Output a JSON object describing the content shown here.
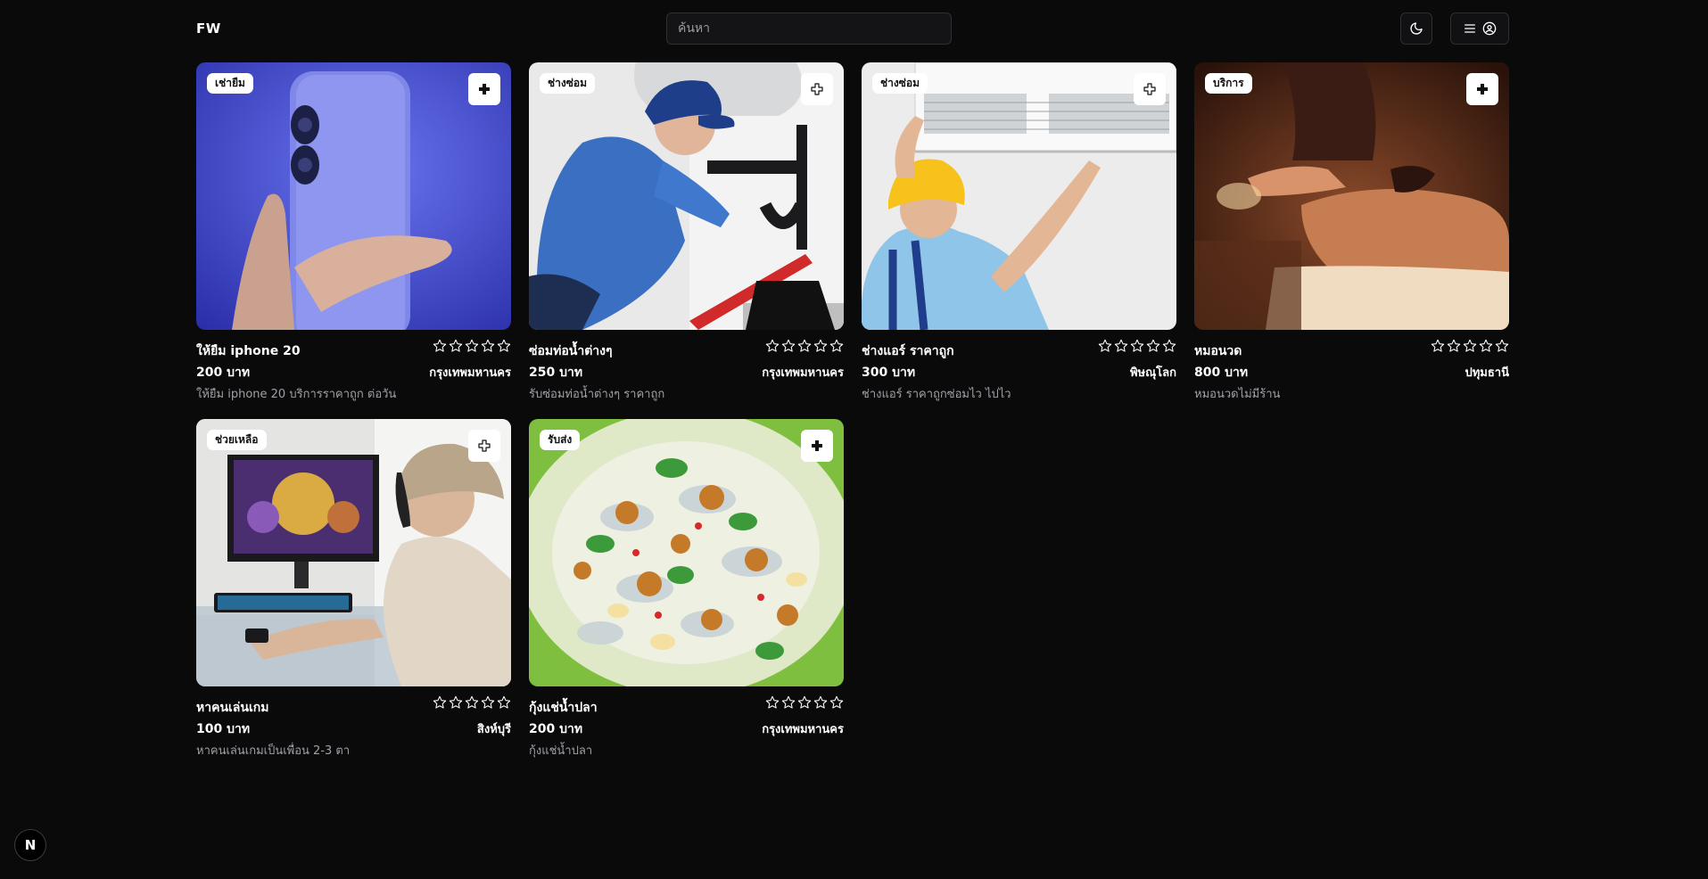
{
  "header": {
    "logo": "FW",
    "search_placeholder": "ค้นหา"
  },
  "listings": [
    {
      "badge": "เช่ายืม",
      "title": "ให้ยืม iphone 20",
      "price": "200 บาท",
      "location": "กรุงเทพมหานคร",
      "description": "ให้ยืม iphone 20 บริการราคาถูก ต่อวัน",
      "rating": 0
    },
    {
      "badge": "ช่างซ่อม",
      "title": "ซ่อมท่อน้ำต่างๆ",
      "price": "250 บาท",
      "location": "กรุงเทพมหานคร",
      "description": "รับซ่อมท่อน้ำต่างๆ ราคาถูก",
      "rating": 0
    },
    {
      "badge": "ช่างซ่อม",
      "title": "ช่างแอร์ ราคาถูก",
      "price": "300 บาท",
      "location": "พิษณุโลก",
      "description": "ช่างแอร์ ราคาถูกซ่อมไว ไปไว",
      "rating": 0
    },
    {
      "badge": "บริการ",
      "title": "หมอนวด",
      "price": "800 บาท",
      "location": "ปทุมธานี",
      "description": "หมอนวดไม่มีร้าน",
      "rating": 0
    },
    {
      "badge": "ช่วยเหลือ",
      "title": "หาคนเล่นเกม",
      "price": "100 บาท",
      "location": "สิงห์บุรี",
      "description": "หาคนเล่นเกมเป็นเพื่อน 2-3 ตา",
      "rating": 0
    },
    {
      "badge": "รับส่ง",
      "title": "กุ้งแช่น้ำปลา",
      "price": "200 บาท",
      "location": "กรุงเทพมหานคร",
      "description": "กุ้งแช่น้ำปลา",
      "rating": 0
    }
  ],
  "dev_indicator": "N"
}
